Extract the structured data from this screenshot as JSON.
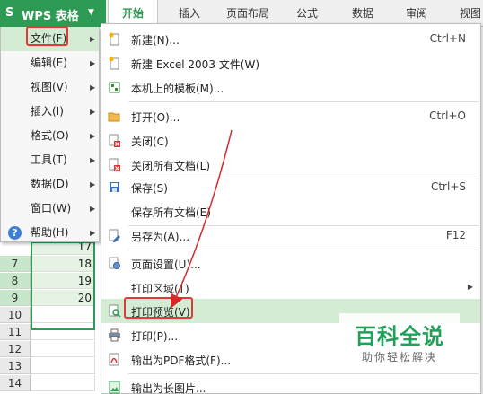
{
  "app": {
    "logo": "S",
    "title": "WPS 表格",
    "menu_arrow": "▼"
  },
  "tabs": [
    {
      "label": "开始",
      "active": true
    },
    {
      "label": "插入"
    },
    {
      "label": "页面布局"
    },
    {
      "label": "公式"
    },
    {
      "label": "数据"
    },
    {
      "label": "审阅"
    },
    {
      "label": "视图"
    }
  ],
  "rows": [
    {
      "num": "7",
      "value": "18"
    },
    {
      "num": "8",
      "value": "19"
    },
    {
      "num": "9",
      "value": "20"
    },
    {
      "num": "10",
      "value": ""
    },
    {
      "num": "11",
      "value": ""
    },
    {
      "num": "12",
      "value": ""
    },
    {
      "num": "13",
      "value": ""
    },
    {
      "num": "14",
      "value": ""
    }
  ],
  "partial_cell_value": "17",
  "left_menu": [
    {
      "label": "文件(F)",
      "highlighted": true
    },
    {
      "label": "编辑(E)"
    },
    {
      "label": "视图(V)"
    },
    {
      "label": "插入(I)"
    },
    {
      "label": "格式(O)"
    },
    {
      "label": "工具(T)"
    },
    {
      "label": "数据(D)"
    },
    {
      "label": "窗口(W)"
    },
    {
      "label": "帮助(H)",
      "icon": "help-icon"
    }
  ],
  "file_menu": [
    {
      "label": "新建(N)...",
      "shortcut": "Ctrl+N",
      "icon": "new-file-icon"
    },
    {
      "label": "新建 Excel 2003 文件(W)",
      "shortcut": "",
      "icon": "new-excel-icon"
    },
    {
      "label": "本机上的模板(M)...",
      "shortcut": "",
      "icon": "template-icon"
    },
    {
      "label": "打开(O)...",
      "shortcut": "Ctrl+O",
      "icon": "folder-open-icon"
    },
    {
      "label": "关闭(C)",
      "shortcut": "",
      "icon": "close-file-icon"
    },
    {
      "label": "关闭所有文档(L)",
      "shortcut": "",
      "icon": "close-all-icon"
    },
    {
      "label": "保存(S)",
      "shortcut": "Ctrl+S",
      "icon": "save-icon"
    },
    {
      "label": "保存所有文档(E)",
      "shortcut": "",
      "icon": ""
    },
    {
      "label": "另存为(A)...",
      "shortcut": "F12",
      "icon": "save-as-icon"
    },
    {
      "label": "页面设置(U)...",
      "shortcut": "",
      "icon": "page-setup-icon"
    },
    {
      "label": "打印区域(T)",
      "shortcut": "",
      "icon": "",
      "submenu": true
    },
    {
      "label": "打印预览(V)",
      "shortcut": "",
      "icon": "print-preview-icon",
      "highlighted": true
    },
    {
      "label": "打印(P)...",
      "shortcut": "",
      "icon": "print-icon"
    },
    {
      "label": "输出为PDF格式(F)...",
      "shortcut": "",
      "icon": "pdf-icon"
    },
    {
      "label": "输出为长图片...",
      "shortcut": "",
      "icon": "long-image-icon"
    }
  ],
  "watermark": {
    "title": "百科全说",
    "subtitle": "助你轻松解决"
  },
  "colors": {
    "brand_green": "#2e9b55",
    "highlight": "#d4ecd4",
    "annotation_red": "#e23838"
  }
}
